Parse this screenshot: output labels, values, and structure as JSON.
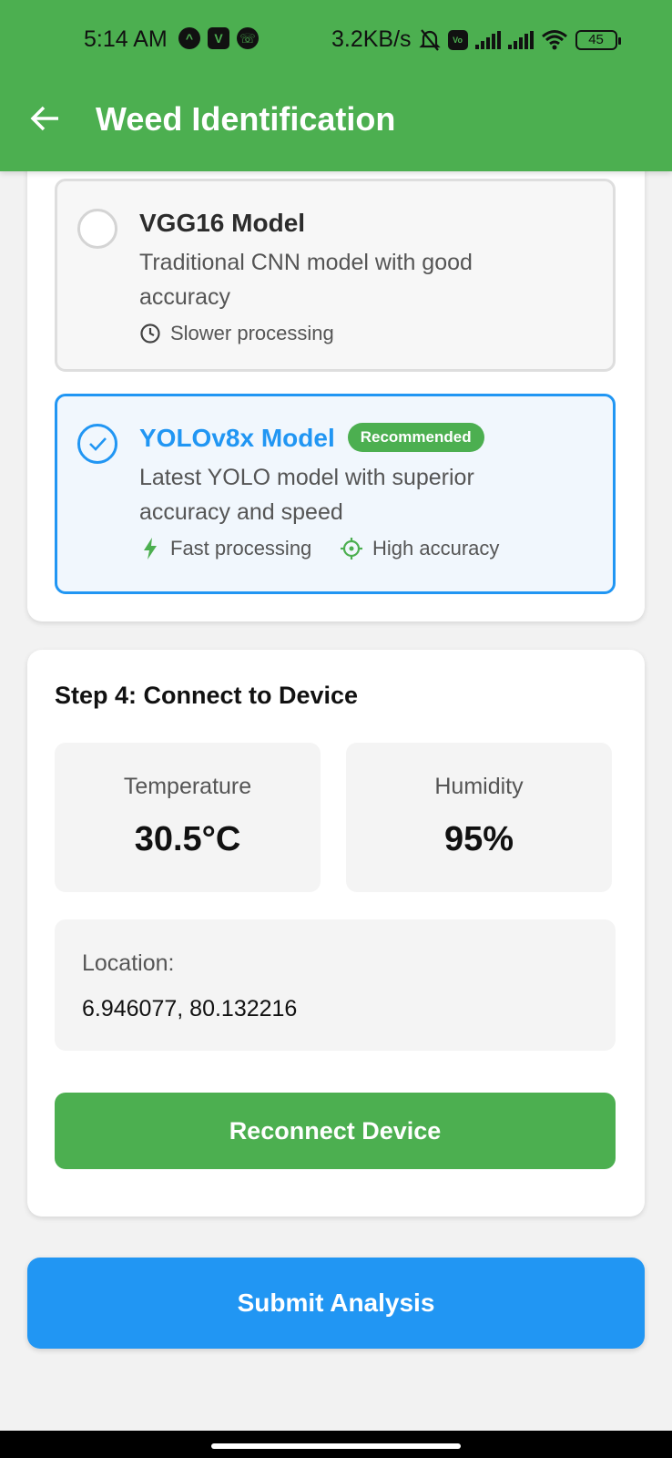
{
  "status_bar": {
    "time": "5:14 AM",
    "network_speed": "3.2KB/s",
    "battery": "45",
    "icons": [
      "app-a-icon",
      "app-v-icon",
      "app-whatsapp-icon",
      "mute-bell-icon",
      "volte-icon",
      "signal-icon",
      "signal-icon",
      "wifi-icon",
      "battery-icon"
    ]
  },
  "app_bar": {
    "title": "Weed Identification",
    "back_icon": "arrow-left-icon",
    "color": "#4caf50"
  },
  "models": [
    {
      "title": "VGG16 Model",
      "description": "Traditional CNN model with good accuracy",
      "selected": false,
      "features": [
        {
          "icon": "clock-icon",
          "label": "Slower processing"
        }
      ]
    },
    {
      "title": "YOLOv8x Model",
      "badge": "Recommended",
      "description": "Latest YOLO model with superior accuracy and speed",
      "selected": true,
      "features": [
        {
          "icon": "lightning-icon",
          "label": "Fast processing"
        },
        {
          "icon": "crosshair-icon",
          "label": "High accuracy"
        }
      ]
    }
  ],
  "device": {
    "step_title": "Step 4: Connect to Device",
    "temperature_label": "Temperature",
    "temperature_value": "30.5°C",
    "humidity_label": "Humidity",
    "humidity_value": "95%",
    "location_label": "Location:",
    "location_value": "6.946077, 80.132216",
    "reconnect_label": "Reconnect Device"
  },
  "submit_label": "Submit Analysis",
  "colors": {
    "primary_green": "#4caf50",
    "primary_blue": "#2196f3"
  }
}
